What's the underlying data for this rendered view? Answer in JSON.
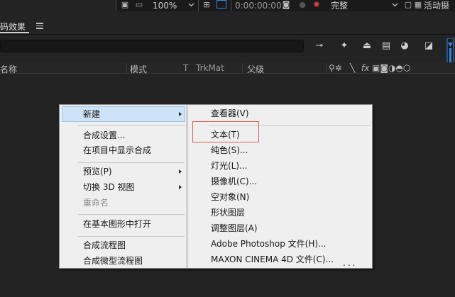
{
  "toolbar": {
    "zoom": "100%",
    "timecode": "0:00:00:00",
    "resolution": "完整",
    "active_camera": "活动摄"
  },
  "panel": {
    "tab_label": "码效果"
  },
  "columns": {
    "name": "名称",
    "mode": "模式",
    "t": "T",
    "trkmat": "TrkMat",
    "parent": "父级",
    "fx": "fx"
  },
  "context_menu": {
    "left": [
      {
        "label": "新建",
        "submenu": true,
        "highlighted": true
      },
      {
        "label": "合成设置..."
      },
      {
        "label": "在项目中显示合成"
      },
      {
        "label": "预览(P)",
        "submenu": true
      },
      {
        "label": "切换 3D 视图",
        "submenu": true
      },
      {
        "label": "重命名",
        "disabled": true
      },
      {
        "label": "在基本图形中打开"
      },
      {
        "label": "合成流程图"
      },
      {
        "label": "合成微型流程图"
      }
    ],
    "right": [
      {
        "label": "查看器(V)"
      },
      {
        "label": "文本(T)",
        "boxed": true
      },
      {
        "label": "纯色(S)..."
      },
      {
        "label": "灯光(L)..."
      },
      {
        "label": "摄像机(C)..."
      },
      {
        "label": "空对象(N)"
      },
      {
        "label": "形状图层"
      },
      {
        "label": "调整图层(A)"
      },
      {
        "label": "Adobe Photoshop 文件(H)..."
      },
      {
        "label": "MAXON CINEMA 4D 文件(C)..."
      }
    ],
    "trailing_dots": "..."
  },
  "colors": {
    "panel_bg": "#232323",
    "menu_bg": "#efefef",
    "highlight": "#cfe3f7",
    "callout_red": "#e0604f",
    "accent_blue": "#2d8ceb"
  }
}
